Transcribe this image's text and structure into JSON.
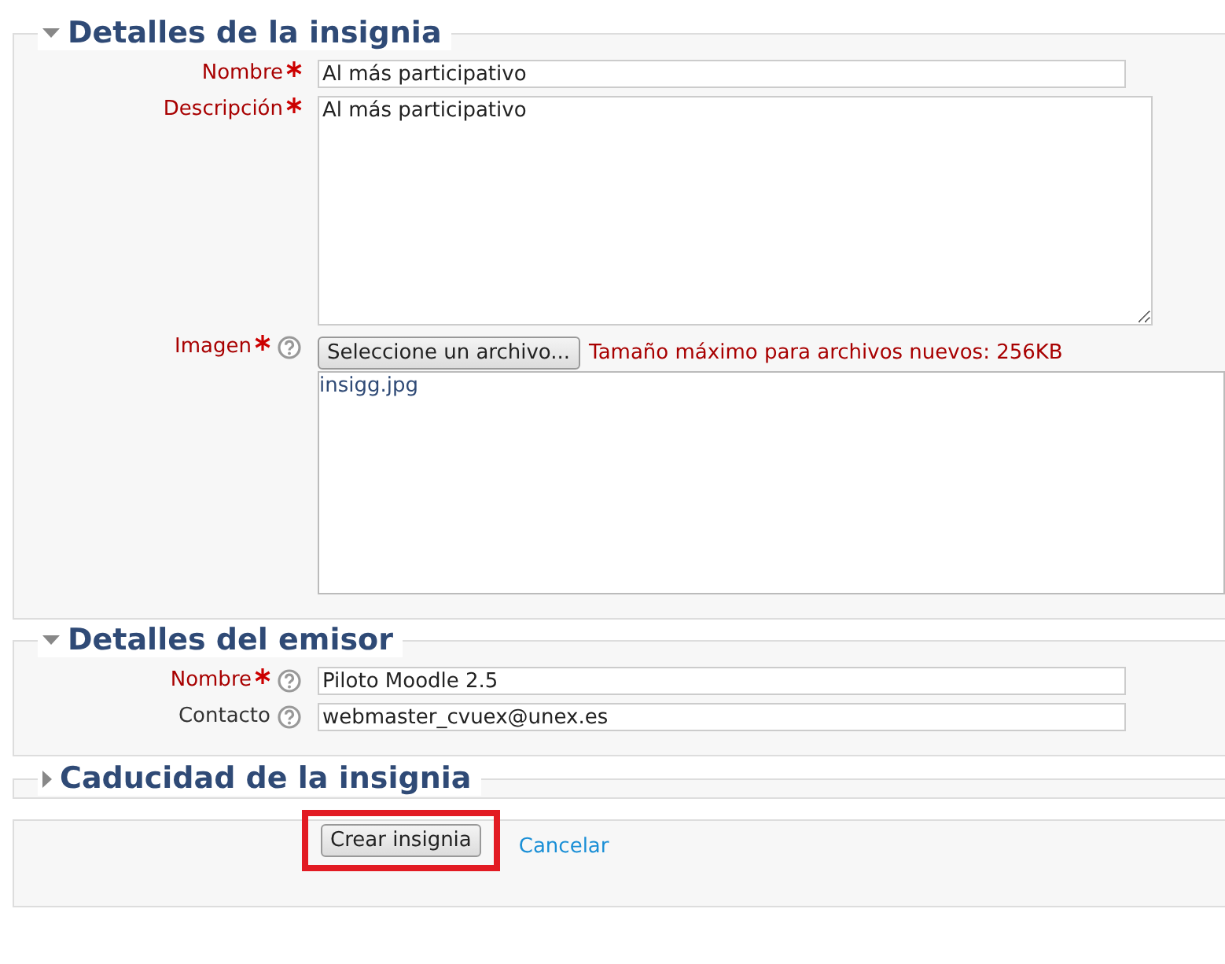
{
  "sections": [
    {
      "title": "Detalles de la insignia",
      "expanded": true,
      "fields": [
        {
          "kind": "text",
          "label": "Nombre",
          "required": true,
          "help": false,
          "value": "Al más participativo"
        },
        {
          "kind": "textarea",
          "label": "Descripción",
          "required": true,
          "help": false,
          "value": "Al más participativo"
        },
        {
          "kind": "file",
          "label": "Imagen",
          "required": true,
          "help": true,
          "button": "Seleccione un archivo...",
          "note": "Tamaño máximo para archivos nuevos: 256KB",
          "files": [
            "insigg.jpg"
          ]
        }
      ]
    },
    {
      "title": "Detalles del emisor",
      "expanded": true,
      "fields": [
        {
          "kind": "text",
          "label": "Nombre",
          "required": true,
          "help": true,
          "value": "Piloto Moodle 2.5"
        },
        {
          "kind": "text",
          "label": "Contacto",
          "required": false,
          "help": true,
          "value": "webmaster_cvuex@unex.es"
        }
      ]
    },
    {
      "title": "Caducidad de la insignia",
      "expanded": false
    }
  ],
  "actions": {
    "submit": "Crear insignia",
    "cancel": "Cancelar",
    "highlighted": true
  }
}
